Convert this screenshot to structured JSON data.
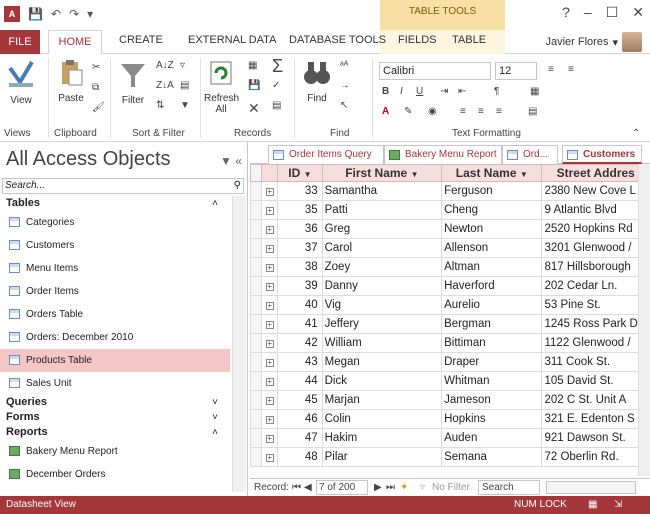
{
  "app": {
    "contextual_banner": "TABLE TOOLS",
    "user_name": "Javier Flores"
  },
  "ribbon_tabs": [
    "FILE",
    "HOME",
    "CREATE",
    "EXTERNAL DATA",
    "DATABASE TOOLS",
    "FIELDS",
    "TABLE"
  ],
  "ribbon": {
    "groups": [
      "Views",
      "Clipboard",
      "Sort & Filter",
      "Records",
      "Find",
      "Text Formatting"
    ],
    "view_label": "View",
    "paste_label": "Paste",
    "filter_label": "Filter",
    "refresh_label": "Refresh",
    "refresh_sub": "All",
    "find_label": "Find",
    "font_name": "Calibri",
    "font_size": "12"
  },
  "nav_pane": {
    "title": "All Access Objects",
    "search_placeholder": "Search...",
    "sections": [
      {
        "name": "Tables",
        "expanded": true,
        "items": [
          "Categories",
          "Customers",
          "Menu Items",
          "Order Items",
          "Orders Table",
          "Orders: December 2010",
          "Products Table",
          "Sales Unit"
        ],
        "selected": "Products Table"
      },
      {
        "name": "Queries",
        "expanded": false,
        "items": []
      },
      {
        "name": "Forms",
        "expanded": false,
        "items": []
      },
      {
        "name": "Reports",
        "expanded": true,
        "items": [
          "Bakery Menu Report",
          "December Orders"
        ]
      }
    ]
  },
  "doc_tabs": [
    "Order Items Query",
    "Bakery Menu Report",
    "Ord...",
    "Customers"
  ],
  "active_doc_tab": "Customers",
  "grid": {
    "columns": [
      "ID",
      "First Name",
      "Last Name",
      "Street Addres"
    ],
    "rows": [
      [
        "33",
        "Samantha",
        "Ferguson",
        "2380 New Cove L"
      ],
      [
        "35",
        "Patti",
        "Cheng",
        "9 Atlantic Blvd"
      ],
      [
        "36",
        "Greg",
        "Newton",
        "2520 Hopkins Rd"
      ],
      [
        "37",
        "Carol",
        "Allenson",
        "3201 Glenwood /"
      ],
      [
        "38",
        "Zoey",
        "Altman",
        "817 Hillsborough"
      ],
      [
        "39",
        "Danny",
        "Haverford",
        "202 Cedar Ln."
      ],
      [
        "40",
        "Vig",
        "Aurelio",
        "53 Pine St."
      ],
      [
        "41",
        "Jeffery",
        "Bergman",
        "1245 Ross Park D"
      ],
      [
        "42",
        "William",
        "Bittiman",
        "1122 Glenwood /"
      ],
      [
        "43",
        "Megan",
        "Draper",
        "311 Cook St."
      ],
      [
        "44",
        "Dick",
        "Whitman",
        "105 David St."
      ],
      [
        "45",
        "Marjan",
        "Jameson",
        "202 C St. Unit A"
      ],
      [
        "46",
        "Colin",
        "Hopkins",
        "321 E. Edenton S"
      ],
      [
        "47",
        "Hakim",
        "Auden",
        "921 Dawson St."
      ],
      [
        "48",
        "Pilar",
        "Semana",
        "72 Oberlin Rd."
      ]
    ]
  },
  "record_nav": {
    "label": "Record:",
    "position": "7 of 200",
    "filter": "No Filter",
    "search": "Search"
  },
  "status": {
    "left": "Datasheet View",
    "numlock": "NUM LOCK"
  }
}
